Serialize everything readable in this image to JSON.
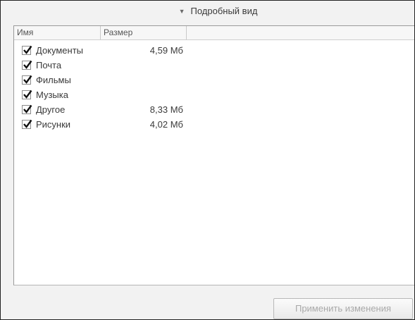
{
  "details": {
    "toggle_label": "Подробный вид",
    "expanded": true
  },
  "table": {
    "columns": [
      "Имя",
      "Размер"
    ],
    "rows": [
      {
        "name": "Документы",
        "size": "4,59 Мб",
        "checked": true
      },
      {
        "name": "Почта",
        "size": "",
        "checked": true
      },
      {
        "name": "Фильмы",
        "size": "",
        "checked": true
      },
      {
        "name": "Музыка",
        "size": "",
        "checked": true
      },
      {
        "name": "Другое",
        "size": "8,33 Мб",
        "checked": true
      },
      {
        "name": "Рисунки",
        "size": "4,02 Мб",
        "checked": true
      }
    ]
  },
  "footer": {
    "apply_label": "Применить изменения",
    "apply_enabled": false
  }
}
